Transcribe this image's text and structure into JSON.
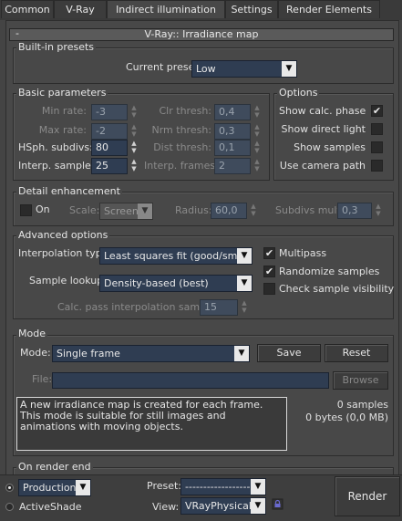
{
  "tabs": [
    "Common",
    "V-Ray",
    "Indirect illumination",
    "Settings",
    "Render Elements"
  ],
  "rollout": {
    "title": "V-Ray:: Irradiance map",
    "collapse": "-"
  },
  "presets": {
    "group": "Built-in presets",
    "label": "Current preset:",
    "value": "Low"
  },
  "basic": {
    "group": "Basic parameters",
    "min_rate_label": "Min rate:",
    "min_rate": "-3",
    "max_rate_label": "Max rate:",
    "max_rate": "-2",
    "hsph_label": "HSph. subdivs:",
    "hsph": "80",
    "interp_label": "Interp. samples:",
    "interp": "25",
    "clr_label": "Clr thresh:",
    "clr": "0,4",
    "nrm_label": "Nrm thresh:",
    "nrm": "0,3",
    "dist_label": "Dist thresh:",
    "dist": "0,1",
    "frames_label": "Interp. frames:",
    "frames": "2"
  },
  "options": {
    "group": "Options",
    "show_calc": "Show calc. phase",
    "show_direct": "Show direct light",
    "show_samples": "Show samples",
    "use_camera": "Use camera path",
    "check": "✔"
  },
  "detail": {
    "group": "Detail enhancement",
    "on": "On",
    "scale_label": "Scale:",
    "scale": "Screen",
    "radius_label": "Radius:",
    "radius": "60,0",
    "subdivs_label": "Subdivs mult.",
    "subdivs": "0,3"
  },
  "advanced": {
    "group": "Advanced options",
    "interp_type_label": "Interpolation type:",
    "interp_type": "Least squares fit (good/smooth",
    "lookup_label": "Sample lookup:",
    "lookup": "Density-based (best)",
    "calc_pass_label": "Calc. pass interpolation samples:",
    "calc_pass": "15",
    "multipass": "Multipass",
    "randomize": "Randomize samples",
    "check_vis": "Check sample visibility",
    "check": "✔"
  },
  "mode": {
    "group": "Mode",
    "mode_label": "Mode:",
    "mode_value": "Single frame",
    "save": "Save",
    "reset": "Reset",
    "file_label": "File:",
    "browse": "Browse",
    "description": "A new irradiance map is created for each frame.\nThis mode is suitable for still images and animations with moving objects.",
    "samples": "0 samples",
    "bytes": "0 bytes (0,0 MB)"
  },
  "render_end": {
    "group": "On render end"
  },
  "bottom": {
    "production": "Production",
    "activeshade": "ActiveShade",
    "preset_label": "Preset:",
    "preset_value": "-----------------------",
    "view_label": "View:",
    "view_value": "VRayPhysicalC",
    "render": "Render"
  }
}
